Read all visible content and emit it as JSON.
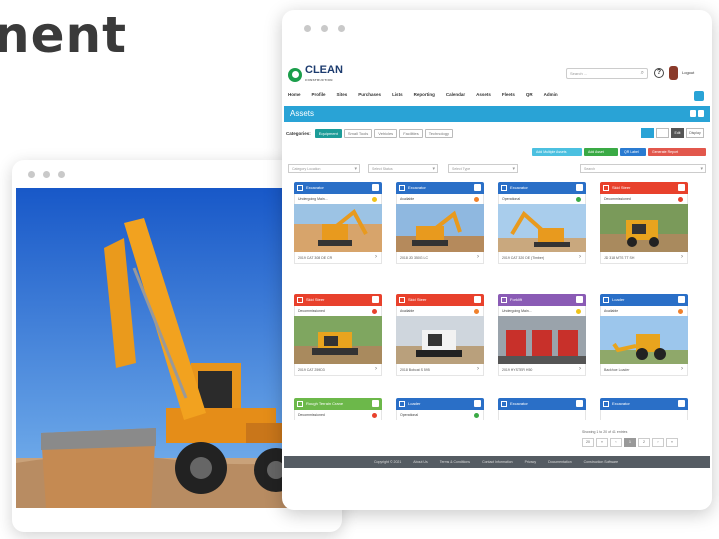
{
  "headline": "nent",
  "app": {
    "logo": {
      "name": "CLEAN",
      "subtitle": "CONSTRUCTION"
    },
    "search_placeholder": "Search ...",
    "help_label": "?",
    "user_name": "Logout",
    "menu": [
      "Home",
      "Profile",
      "Sites",
      "Purchases",
      "Lists",
      "Reporting",
      "Calendar",
      "Assets",
      "Fleets",
      "QR",
      "Admin"
    ],
    "page_title": "Assets",
    "categories_label": "Categories:",
    "categories": [
      "Equipment",
      "Small Tools",
      "Vehicles",
      "Facilities",
      "Technology"
    ],
    "view_tools": [
      "",
      "",
      "Edit",
      "Display"
    ],
    "actions": [
      "Add Multiple Assets",
      "Add Asset",
      "QR Label",
      "Generate Report"
    ],
    "filters": [
      "Category Location",
      "Select Status",
      "Select Type",
      "Search"
    ],
    "cards": [
      {
        "status_label": "Excavator",
        "status_color": "#2a6fc7",
        "condition": "Undergoing Main...",
        "cond_color": "#f0c419",
        "footer": "2019 CAT 308 DE CR",
        "img": "excavator"
      },
      {
        "status_label": "Excavator",
        "status_color": "#2a6fc7",
        "condition": "Available",
        "cond_color": "#f0812b",
        "footer": "2018 JD 350G LC",
        "img": "excavator2"
      },
      {
        "status_label": "Excavator",
        "status_color": "#2a6fc7",
        "condition": "Operational",
        "cond_color": "#3aaa45",
        "footer": "2019 CAT 320 DE (Timber)",
        "img": "excavator3"
      },
      {
        "status_label": "Skid Steer",
        "status_color": "#e8412c",
        "condition": "Decommissioned",
        "cond_color": "#e8412c",
        "footer": "JD 318 MTS TT SH",
        "img": "skid"
      },
      {
        "status_label": "Skid Steer",
        "status_color": "#e8412c",
        "condition": "Decommissioned",
        "cond_color": "#e8412c",
        "footer": "2019 CAT 259D3",
        "img": "skid2"
      },
      {
        "status_label": "Skid Steer",
        "status_color": "#e8412c",
        "condition": "Available",
        "cond_color": "#f0812b",
        "footer": "2018 Bobcat S 595",
        "img": "bobcat"
      },
      {
        "status_label": "Forklift",
        "status_color": "#8a5bb5",
        "condition": "Undergoing Main...",
        "cond_color": "#f0c419",
        "footer": "2019 HYSTER H50",
        "img": "forklift"
      },
      {
        "status_label": "Loader",
        "status_color": "#2a6fc7",
        "condition": "Available",
        "cond_color": "#f0812b",
        "footer": "Backhoe Loader",
        "img": "loader"
      },
      {
        "status_label": "Rough Terrain Crane",
        "status_color": "#6cb84a",
        "condition": "Decommissioned",
        "cond_color": "#e8412c",
        "footer": "",
        "img": ""
      },
      {
        "status_label": "Loader",
        "status_color": "#2a6fc7",
        "condition": "Operational",
        "cond_color": "#3aaa45",
        "footer": "",
        "img": ""
      },
      {
        "status_label": "Excavator",
        "status_color": "#2a6fc7",
        "condition": "",
        "cond_color": "",
        "footer": "",
        "img": ""
      },
      {
        "status_label": "Excavator",
        "status_color": "#2a6fc7",
        "condition": "",
        "cond_color": "",
        "footer": "",
        "img": ""
      }
    ],
    "pager_text": "Showing 1 to 20 of 41 entries",
    "pages": [
      "20",
      "«",
      "‹",
      "1",
      "2",
      "›",
      "»"
    ],
    "footer_items": [
      "Copyright © 2021",
      "About Us",
      "Terms & Conditions",
      "Contact Information",
      "Privacy",
      "Documentation",
      "Construction Software"
    ]
  }
}
